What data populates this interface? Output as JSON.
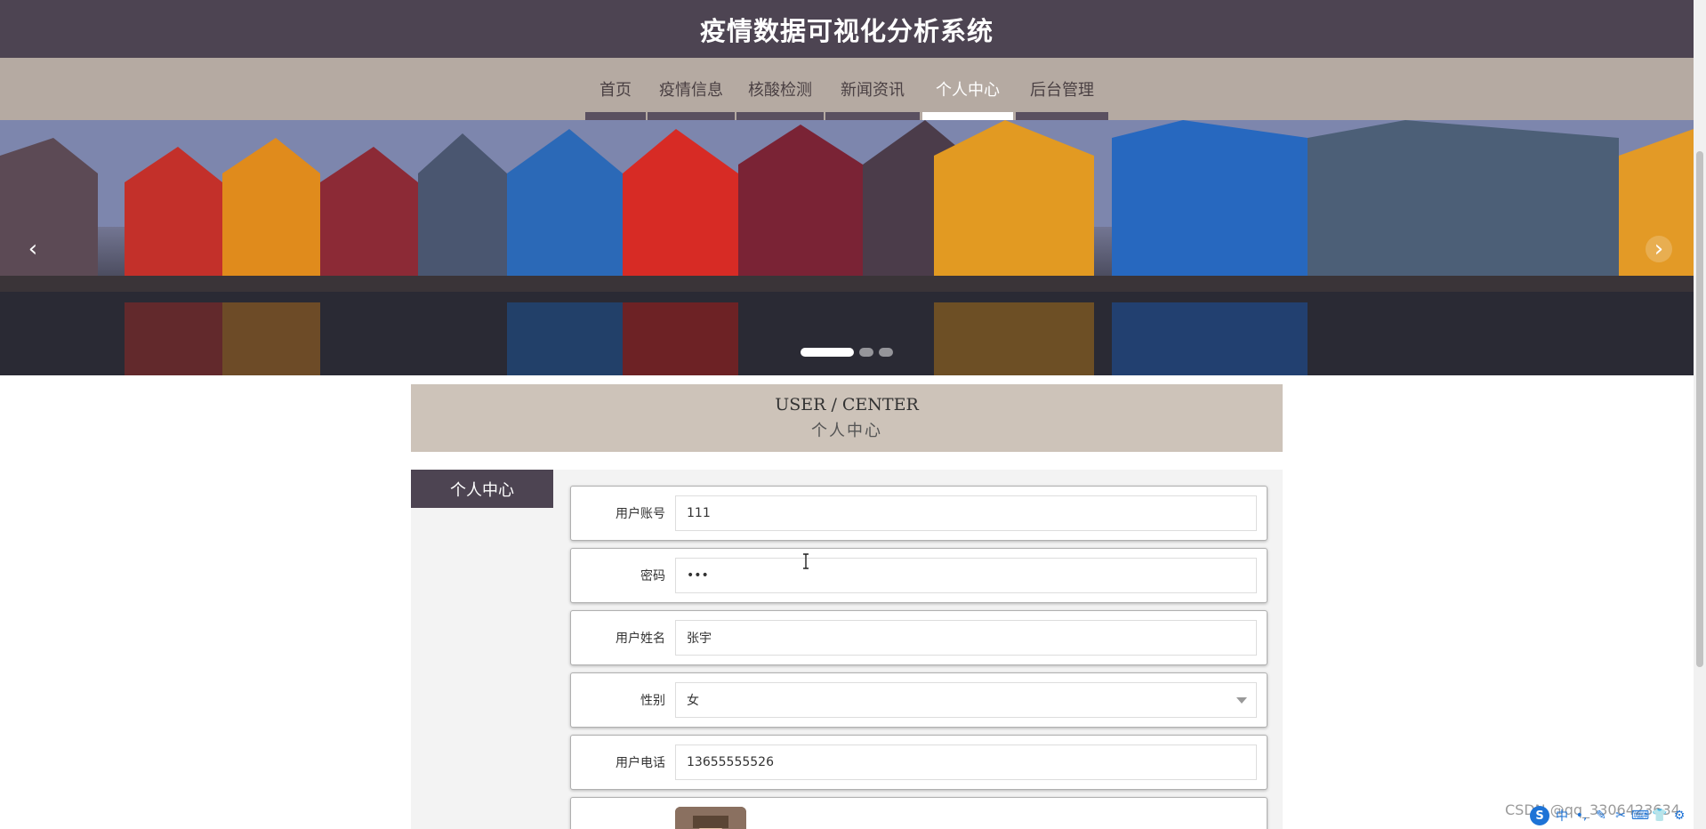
{
  "header": {
    "title": "疫情数据可视化分析系统"
  },
  "nav": {
    "items": [
      {
        "label": "首页",
        "active": false
      },
      {
        "label": "疫情信息",
        "active": false
      },
      {
        "label": "核酸检测",
        "active": false
      },
      {
        "label": "新闻资讯",
        "active": false
      },
      {
        "label": "个人中心",
        "active": true
      },
      {
        "label": "后台管理",
        "active": false
      }
    ]
  },
  "banner": {
    "prev_icon": "chevron-left-icon",
    "next_icon": "chevron-right-icon",
    "slide_count": 3,
    "active_slide": 1
  },
  "section": {
    "title_en": "USER / CENTER",
    "title_cn": "个人中心"
  },
  "sidebar": {
    "tab_label": "个人中心"
  },
  "form": {
    "fields": [
      {
        "label": "用户账号",
        "value": "111",
        "type": "text"
      },
      {
        "label": "密码",
        "value": "•••",
        "type": "password"
      },
      {
        "label": "用户姓名",
        "value": "张宇",
        "type": "text"
      },
      {
        "label": "性别",
        "value": "女",
        "type": "select"
      },
      {
        "label": "用户电话",
        "value": "13655555526",
        "type": "text"
      }
    ]
  },
  "watermark": {
    "text": "CSDN @qq_3306423634"
  },
  "ime": {
    "logo": "S",
    "icons": [
      "中",
      "•,",
      "✎",
      "✂",
      "⌨",
      "👕",
      "⚙"
    ]
  }
}
